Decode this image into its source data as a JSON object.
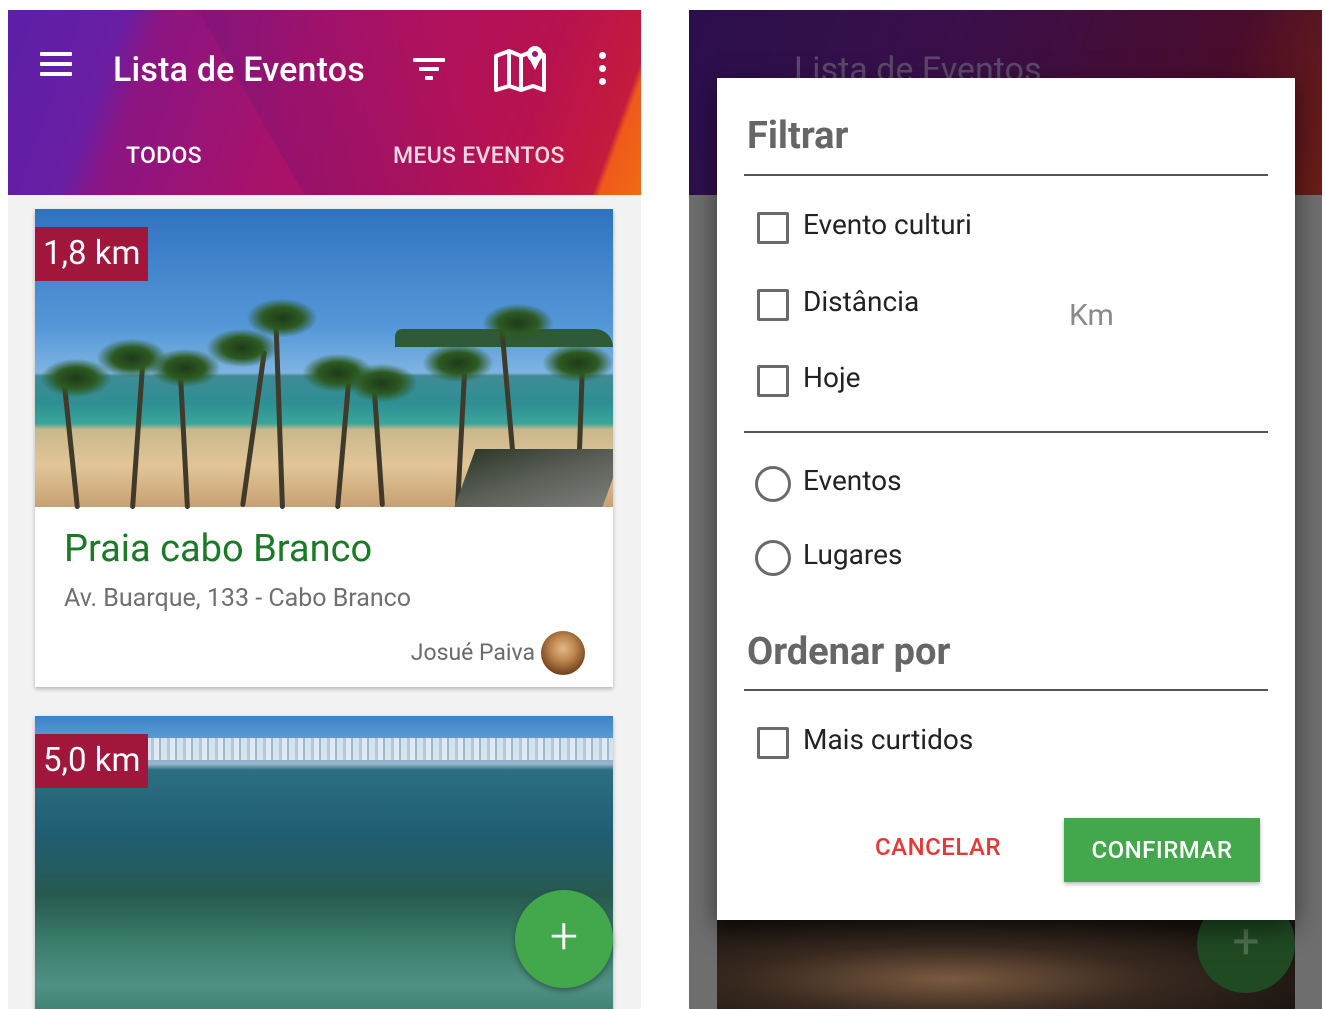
{
  "left": {
    "appbar": {
      "title": "Lista de Eventos",
      "icons": [
        "menu-icon",
        "filter-icon",
        "map-icon",
        "more-vert-icon"
      ]
    },
    "tabs": [
      {
        "label": "TODOS",
        "selected": true
      },
      {
        "label": "MEUS EVENTOS",
        "selected": false
      }
    ],
    "cards": [
      {
        "distance": "1,8 km",
        "title": "Praia cabo Branco",
        "address": "Av. Buarque, 133 - Cabo Branco",
        "author": "Josué Paiva"
      },
      {
        "distance": "5,0 km"
      }
    ],
    "fab": {
      "label": "+",
      "icon": "add-icon"
    }
  },
  "right": {
    "dialog": {
      "filter_title": "Filtrar",
      "filters": [
        {
          "label": "Evento culturi",
          "checked": false
        },
        {
          "label": "Distância",
          "checked": false,
          "unit": "Km"
        },
        {
          "label": "Hoje",
          "checked": false
        }
      ],
      "types": [
        {
          "label": "Eventos",
          "selected": false
        },
        {
          "label": "Lugares",
          "selected": false
        }
      ],
      "order_title": "Ordenar por",
      "order_options": [
        {
          "label": "Mais curtidos",
          "checked": false
        }
      ],
      "cancel_label": "CANCELAR",
      "confirm_label": "CONFIRMAR"
    },
    "background_title": "Lista de Eventos"
  },
  "colors": {
    "accent_green": "#43a84b",
    "title_green": "#1a7a25",
    "badge": "#a1163b",
    "cancel_red": "#e53935"
  }
}
